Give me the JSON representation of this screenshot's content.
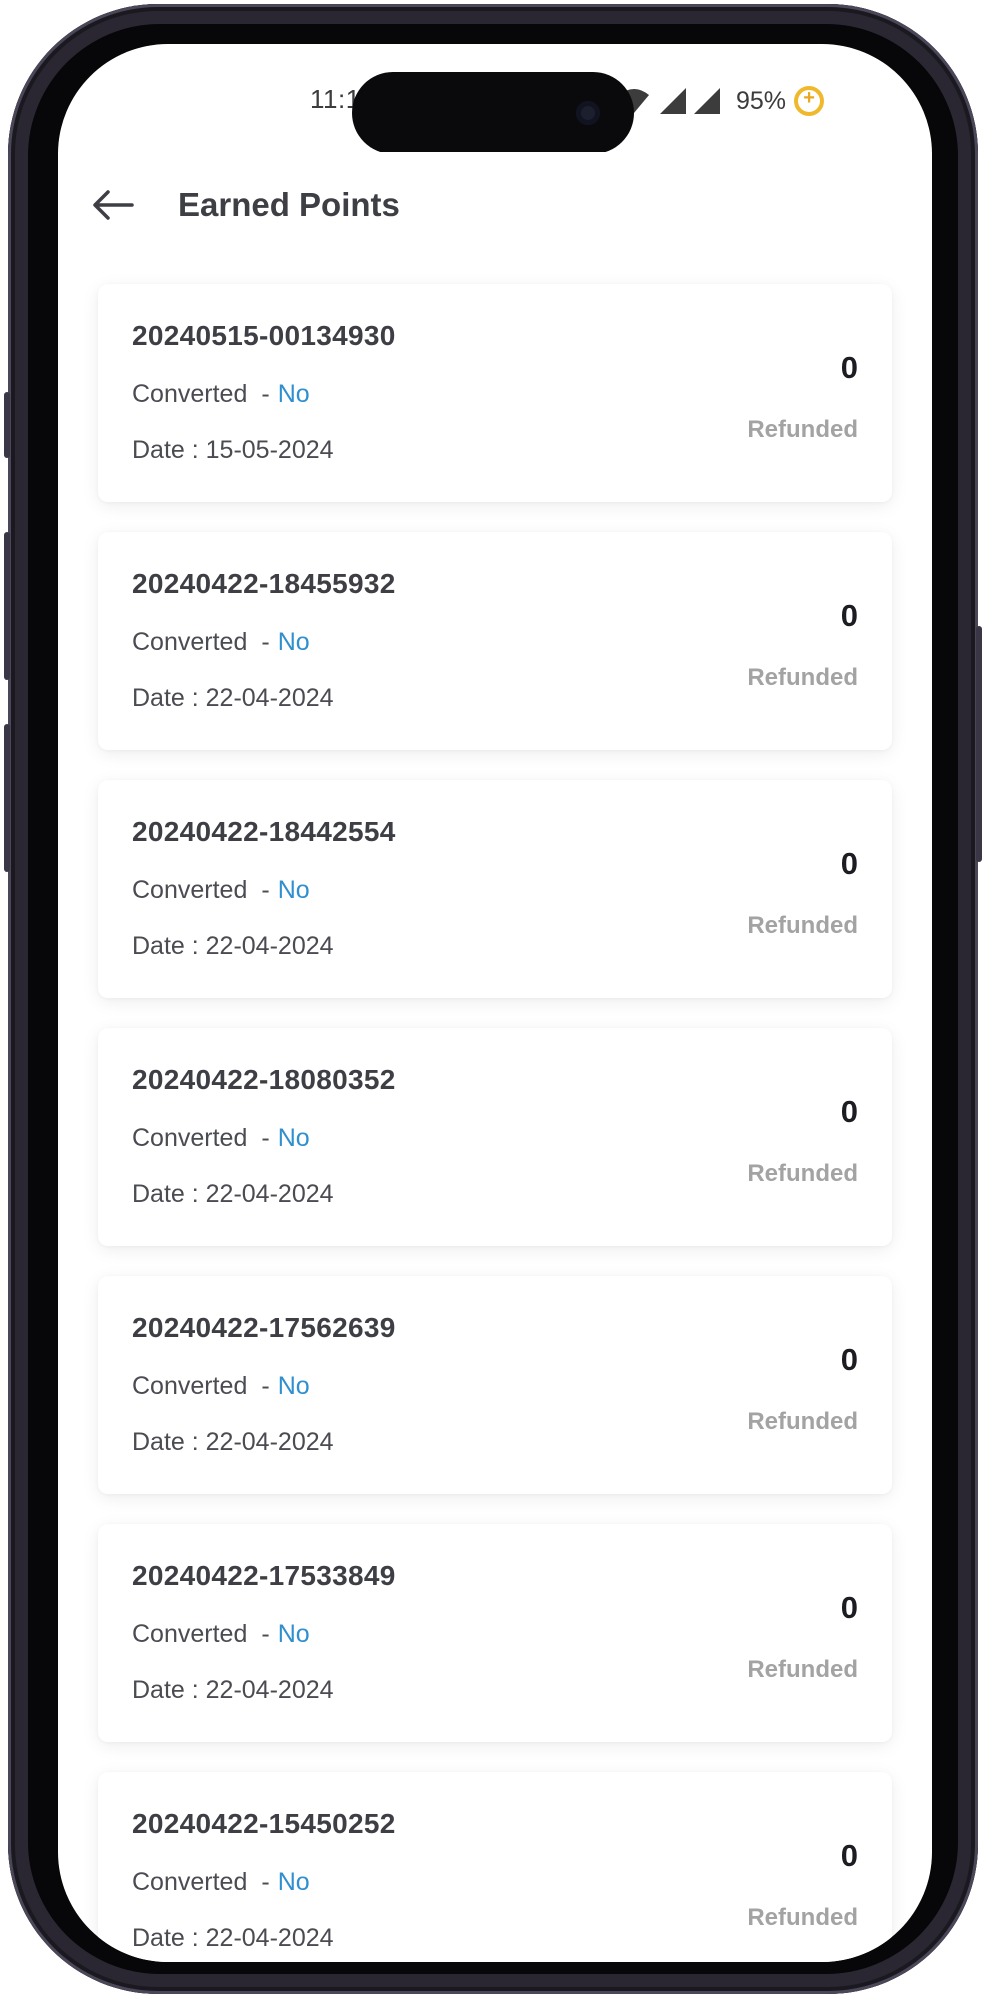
{
  "status_bar": {
    "time": "11:1",
    "battery": "95%",
    "icons": [
      "wifi-icon",
      "signal-icon",
      "signal-icon",
      "battery-saver-icon"
    ]
  },
  "header": {
    "title": "Earned Points",
    "back_icon": "arrow-left-icon"
  },
  "entries": [
    {
      "id": "20240515-00134930",
      "converted_label": "Converted",
      "converted_sep": "-",
      "converted_value": "No",
      "date": "Date : 15-05-2024",
      "points": "0",
      "status": "Refunded"
    },
    {
      "id": "20240422-18455932",
      "converted_label": "Converted",
      "converted_sep": "-",
      "converted_value": "No",
      "date": "Date : 22-04-2024",
      "points": "0",
      "status": "Refunded"
    },
    {
      "id": "20240422-18442554",
      "converted_label": "Converted",
      "converted_sep": "-",
      "converted_value": "No",
      "date": "Date : 22-04-2024",
      "points": "0",
      "status": "Refunded"
    },
    {
      "id": "20240422-18080352",
      "converted_label": "Converted",
      "converted_sep": "-",
      "converted_value": "No",
      "date": "Date : 22-04-2024",
      "points": "0",
      "status": "Refunded"
    },
    {
      "id": "20240422-17562639",
      "converted_label": "Converted",
      "converted_sep": "-",
      "converted_value": "No",
      "date": "Date : 22-04-2024",
      "points": "0",
      "status": "Refunded"
    },
    {
      "id": "20240422-17533849",
      "converted_label": "Converted",
      "converted_sep": "-",
      "converted_value": "No",
      "date": "Date : 22-04-2024",
      "points": "0",
      "status": "Refunded"
    },
    {
      "id": "20240422-15450252",
      "converted_label": "Converted",
      "converted_sep": "-",
      "converted_value": "No",
      "date": "Date : 22-04-2024",
      "points": "0",
      "status": "Refunded"
    }
  ],
  "colors": {
    "accent_link": "#2f8fcf",
    "title_text": "#3d3f44",
    "status_text": "#a3a3a3",
    "battery_saver": "#f0b92b"
  }
}
